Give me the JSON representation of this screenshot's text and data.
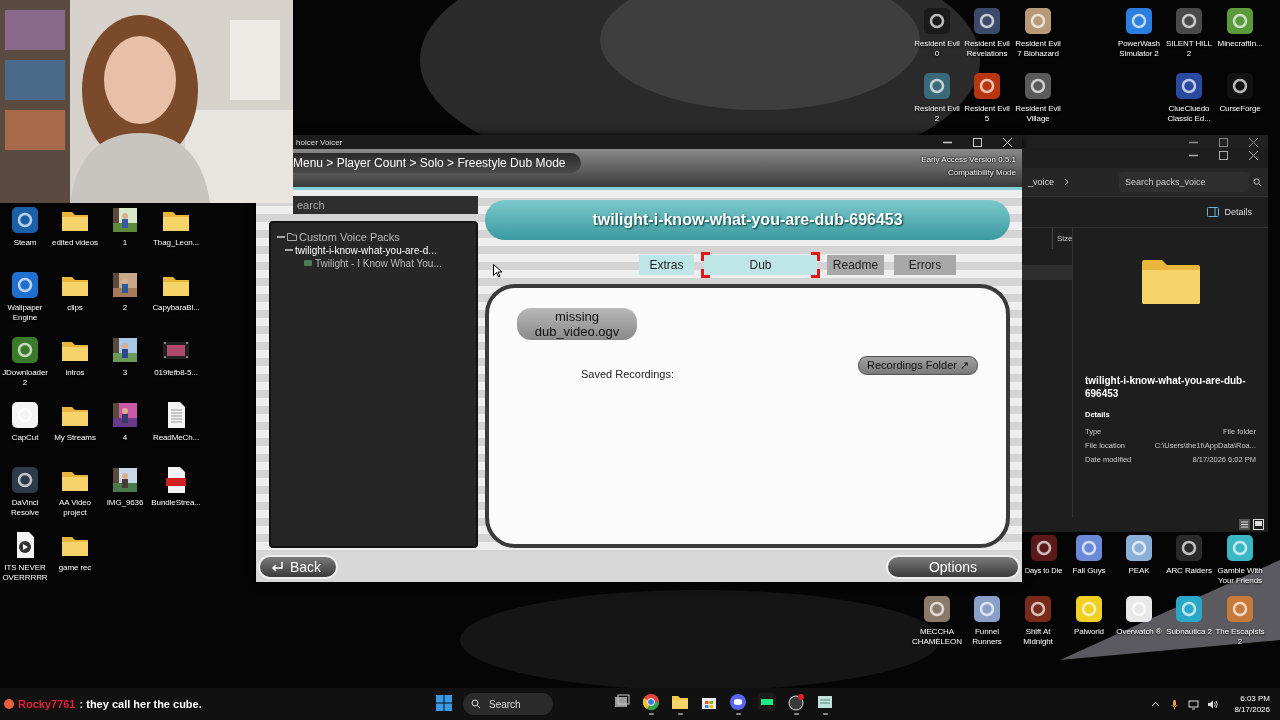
{
  "desktop": {
    "left": [
      {
        "label": "Steam",
        "kind": "app",
        "color": "#1b5fa8"
      },
      {
        "label": "edited videos",
        "kind": "folder"
      },
      {
        "label": "1"
      },
      {
        "label": "Tbag_Leon...",
        "kind": "folder"
      },
      {
        "label": "Wallpaper Engine",
        "kind": "app",
        "color": "#1f6fd1"
      },
      {
        "label": "clips",
        "kind": "folder"
      },
      {
        "label": "2"
      },
      {
        "label": "CapybaraBl...",
        "kind": "folder"
      },
      {
        "label": "JDownloader 2",
        "kind": "app",
        "color": "#3a7a2a"
      },
      {
        "label": "intros",
        "kind": "folder"
      },
      {
        "label": "3"
      },
      {
        "label": "019fefb8-5...",
        "kind": "video"
      },
      {
        "label": "CapCut",
        "kind": "app",
        "color": "#f4f4f4"
      },
      {
        "label": "My Streams",
        "kind": "folder"
      },
      {
        "label": "4"
      },
      {
        "label": "ReadMeCh...",
        "kind": "document"
      },
      {
        "label": "DaVinci Resolve",
        "kind": "app",
        "color": "#2d3a4a"
      },
      {
        "label": "AA Video project",
        "kind": "folder"
      },
      {
        "label": "IMG_9636"
      },
      {
        "label": "BundleStrea...",
        "kind": "pdf"
      },
      {
        "label": "ITS  NEVER OVERRRRR",
        "kind": "media"
      },
      {
        "label": "game rec",
        "kind": "folder"
      }
    ],
    "top": [
      {
        "label": "Resident Evil 0",
        "kind": "app",
        "color": "#1a1a1a"
      },
      {
        "label": "Resident Evil Revelations",
        "kind": "app",
        "color": "#3b4a6b"
      },
      {
        "label": "Resident Evil 7 Biohazard",
        "kind": "app",
        "color": "#b89a78"
      },
      {
        "label": "PowerWash Simulator 2",
        "kind": "app",
        "color": "#2a7fe0"
      },
      {
        "label": "SILENT HILL 2",
        "kind": "app",
        "color": "#4a4a4a"
      },
      {
        "label": "MinecraftIn...",
        "kind": "app",
        "color": "#5a9a3a"
      },
      {
        "label": "Resident Evil 2",
        "kind": "app",
        "color": "#3a6a7a"
      },
      {
        "label": "Resident Evil 5",
        "kind": "app",
        "color": "#b8360f"
      },
      {
        "label": "Resident Evil Village",
        "kind": "app",
        "color": "#5a5a5a"
      },
      {
        "label": "ClueCluedo Classic Ed...",
        "kind": "app",
        "color": "#2a4aa0"
      },
      {
        "label": "CurseForge",
        "kind": "app",
        "color": "#111111"
      }
    ],
    "bottom": [
      {
        "label": "Days to Die",
        "kind": "app",
        "color": "#5a1a1a"
      },
      {
        "label": "Fall Guys",
        "kind": "app",
        "color": "#6a8ad8"
      },
      {
        "label": "PEAK",
        "kind": "app",
        "color": "#8ab0d8"
      },
      {
        "label": "ARC Raiders",
        "kind": "app",
        "color": "#2a2a2a"
      },
      {
        "label": "Gamble With Your Friends",
        "kind": "app",
        "color": "#3ab8c8"
      },
      {
        "label": "MECCHA CHAMELEON",
        "kind": "app",
        "color": "#8a7a6a"
      },
      {
        "label": "Funnel Runners",
        "kind": "app",
        "color": "#8aa0c8"
      },
      {
        "label": "Shift At Midnight",
        "kind": "app",
        "color": "#7a2a1a"
      },
      {
        "label": "Palworld",
        "kind": "app",
        "color": "#f0d020"
      },
      {
        "label": "Overwatch ®",
        "kind": "app",
        "color": "#e8e8e8"
      },
      {
        "label": "Subnautica 2",
        "kind": "app",
        "color": "#2aa8c8"
      },
      {
        "label": "The Escapists 2",
        "kind": "app",
        "color": "#c87a3a"
      }
    ]
  },
  "app_window": {
    "title": "hoicer Voicer",
    "breadcrumb": "Menu > Player Count > Solo > Freestyle Dub Mode",
    "version": "Early Access Version 0.5.1",
    "mode": "Compatibility Mode",
    "search": {
      "placeholder": "earch"
    },
    "tree": [
      {
        "label": "Custom Voice Packs",
        "kind": "folder",
        "expanded": true,
        "children": [
          {
            "label": "twilight-i-know-what-you-are-d...",
            "expanded": true,
            "children": [
              {
                "label": "Twilight - I Know What You...",
                "kind": "pack"
              }
            ]
          }
        ]
      }
    ],
    "pack_title": "twilight-i-know-what-you-are-dub-696453",
    "tabs": [
      {
        "label": "Extras",
        "selected": false,
        "available": true
      },
      {
        "label": "Dub",
        "selected": true,
        "available": true
      },
      {
        "label": "Readme",
        "selected": false,
        "available": false
      },
      {
        "label": "Errors",
        "selected": false,
        "available": false
      }
    ],
    "media_status": "missing dub_video.ogv",
    "saved_label": "Saved Recordings:",
    "folder_button": "Recordings Folder ↗",
    "back_button": "Back",
    "options_button": "Options"
  },
  "explorer": {
    "address": "_voice",
    "search": {
      "placeholder": "Search packs_voice"
    },
    "details_button": "Details",
    "column": "Size",
    "preview": {
      "name": "twilight-i-know-what-you-are-dub-696453",
      "section": "Details",
      "fields": [
        {
          "label": "Type",
          "value": "File folder"
        },
        {
          "label": "File location",
          "value": "C:\\Users\\the1t\\AppData\\Roa..."
        },
        {
          "label": "Date modified",
          "value": "8/17/2026 6:02 PM"
        }
      ]
    }
  },
  "taskbar": {
    "chat": {
      "user": "Rocky7761",
      "message": ": they call her the cube."
    },
    "search": "Search",
    "apps": [
      {
        "kind": "window",
        "color": "#9a9a9a",
        "running": false
      },
      {
        "kind": "browser",
        "color": "#e8453c",
        "running": true
      },
      {
        "kind": "folder",
        "color": "#f2c94c",
        "running": true
      },
      {
        "kind": "store",
        "color": "#3a8ee6",
        "running": false
      },
      {
        "kind": "chat",
        "color": "#5865f2",
        "running": true
      },
      {
        "kind": "tv",
        "color": "#1ce783",
        "running": false
      },
      {
        "kind": "recorder",
        "color": "#3a3a3a",
        "running": true
      },
      {
        "kind": "notepad",
        "color": "#bfe3d8",
        "running": true
      }
    ],
    "time": "6:03 PM",
    "date": "8/17/2026"
  }
}
